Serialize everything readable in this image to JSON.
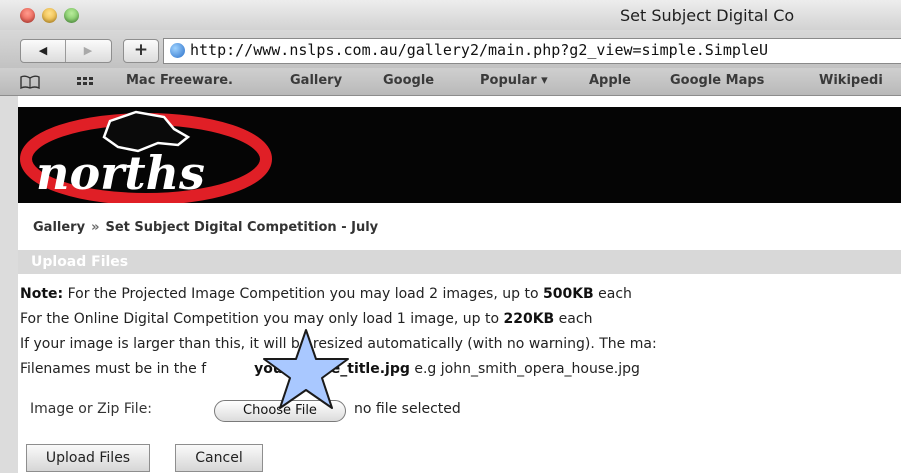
{
  "window": {
    "title": "Set Subject Digital Co"
  },
  "toolbar": {
    "back_icon": "back-arrow-icon",
    "forward_icon": "forward-arrow-icon",
    "back_glyph": "◀",
    "forward_glyph": "▶",
    "add_glyph": "+",
    "url": "http://www.nslps.com.au/gallery2/main.php?g2_view=simple.SimpleU"
  },
  "bookmarks": {
    "items": [
      "Mac Freeware.",
      "Gallery",
      "Google",
      "Popular ▾",
      "Apple",
      "Google Maps",
      "Wikipedi"
    ]
  },
  "banner": {
    "logo_text": "norths",
    "brand_red": "#e01f26"
  },
  "breadcrumb": {
    "root": "Gallery",
    "separator": "»",
    "current": "Set Subject Digital Competition - July"
  },
  "section": {
    "title": "Upload Files"
  },
  "notes": {
    "line1": {
      "prefix": "Note:",
      "text_a": " For the Projected Image Competition you may load 2 images, up to ",
      "size": "500KB",
      "text_b": " each"
    },
    "line2": {
      "text_a": "For the Online Digital Competition you may only load 1 image, up to ",
      "size": "220KB",
      "text_b": " each"
    },
    "line3": "If your image is larger than this, it will be resized automatically (with no warning). The ma:",
    "line4": {
      "text_a": "Filenames must be in the f",
      "format": "your_name_title.jpg",
      "text_b": " e.g john_smith_opera_house.jpg"
    }
  },
  "file_input": {
    "label": "Image or Zip File:",
    "button": "Choose File",
    "status": "no file selected"
  },
  "buttons": {
    "upload": "Upload Files",
    "cancel": "Cancel"
  },
  "overlay": {
    "star_icon": "star-marker-icon",
    "star_color": "#a9c8ff"
  }
}
